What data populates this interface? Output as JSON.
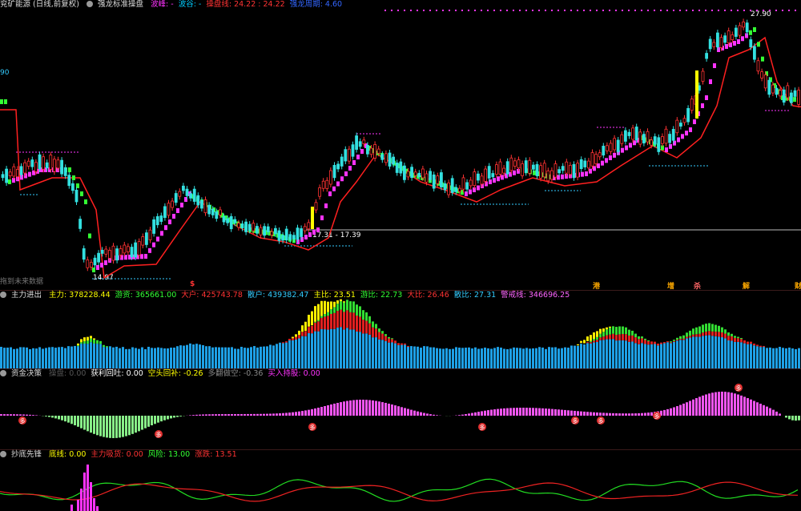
{
  "main": {
    "title": "兖矿能源 (日线,前复权)",
    "indicator": "强龙标准操盘",
    "items": [
      {
        "label": "波峰:",
        "value": "-",
        "color": "#ff33ff"
      },
      {
        "label": "波谷:",
        "value": "-",
        "color": "#00ccff"
      },
      {
        "label": "操盘线:",
        "value": "24.22 : 24.22",
        "color": "#ff3333"
      },
      {
        "label": "强龙周期:",
        "value": "4.60",
        "color": "#3366ff"
      }
    ],
    "left_value": "90",
    "future_note": "拖到未来数据",
    "annotations": {
      "high": "27.90",
      "low": "14.97",
      "range": "17.31 - 17.39"
    },
    "events": [
      "$",
      "港",
      "增",
      "杀",
      "解",
      "财"
    ]
  },
  "pane2": {
    "title": "主力进出",
    "items": [
      {
        "label": "主力:",
        "value": "378228.44",
        "color": "#ffff00"
      },
      {
        "label": "游资:",
        "value": "365661.00",
        "color": "#33ff33"
      },
      {
        "label": "大户:",
        "value": "425743.78",
        "color": "#ff3333"
      },
      {
        "label": "散户:",
        "value": "439382.47",
        "color": "#33ccff"
      },
      {
        "label": "主比:",
        "value": "23.51",
        "color": "#ffff00"
      },
      {
        "label": "游比:",
        "value": "22.73",
        "color": "#33ff33"
      },
      {
        "label": "大比:",
        "value": "26.46",
        "color": "#ff3333"
      },
      {
        "label": "散比:",
        "value": "27.31",
        "color": "#33ccff"
      },
      {
        "label": "警戒线:",
        "value": "346696.25",
        "color": "#ff66ff"
      }
    ]
  },
  "pane3": {
    "title": "资金决策",
    "items": [
      {
        "label": "操盘:",
        "value": "0.00",
        "color": "#555555"
      },
      {
        "label": "获利回吐:",
        "value": "0.00",
        "color": "#ffffff"
      },
      {
        "label": "空头回补:",
        "value": "-0.26",
        "color": "#ffff00"
      },
      {
        "label": "多翻做空:",
        "value": "-0.36",
        "color": "#888888"
      },
      {
        "label": "买入持股:",
        "value": "0.00",
        "color": "#ff33ff"
      }
    ],
    "badge": "多"
  },
  "pane4": {
    "title": "抄底先锋",
    "items": [
      {
        "label": "底线:",
        "value": "0.00",
        "color": "#ffff00"
      },
      {
        "label": "主力吸货:",
        "value": "0.00",
        "color": "#ff3333"
      },
      {
        "label": "风险:",
        "value": "13.00",
        "color": "#33ff33"
      },
      {
        "label": "涨跌:",
        "value": "13.51",
        "color": "#ff3333"
      }
    ]
  },
  "colors": {
    "up": "#ff3333",
    "down": "#33e0e0",
    "bull": "#ff33ff",
    "bear": "#33ff33",
    "support": "#ff2020"
  }
}
